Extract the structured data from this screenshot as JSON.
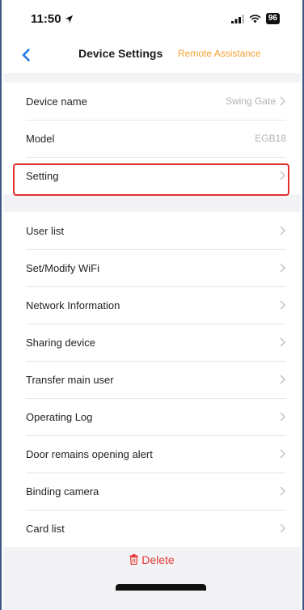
{
  "status_bar": {
    "time": "11:50",
    "battery": "96"
  },
  "nav": {
    "title": "Device Settings",
    "action": "Remote Assistance"
  },
  "info_group": [
    {
      "label": "Device name",
      "value": "Swing Gate"
    },
    {
      "label": "Model",
      "value": "EGB18"
    },
    {
      "label": "Setting",
      "value": ""
    }
  ],
  "menu_group": [
    {
      "label": "User list"
    },
    {
      "label": "Set/Modify WiFi"
    },
    {
      "label": "Network Information"
    },
    {
      "label": "Sharing device"
    },
    {
      "label": "Transfer main user"
    },
    {
      "label": "Operating Log"
    },
    {
      "label": "Door remains opening alert"
    },
    {
      "label": "Binding camera"
    },
    {
      "label": "Card list"
    }
  ],
  "delete_label": "Delete",
  "colors": {
    "accent": "#f2a134",
    "danger": "#e53935",
    "highlight": "#e0302b"
  }
}
